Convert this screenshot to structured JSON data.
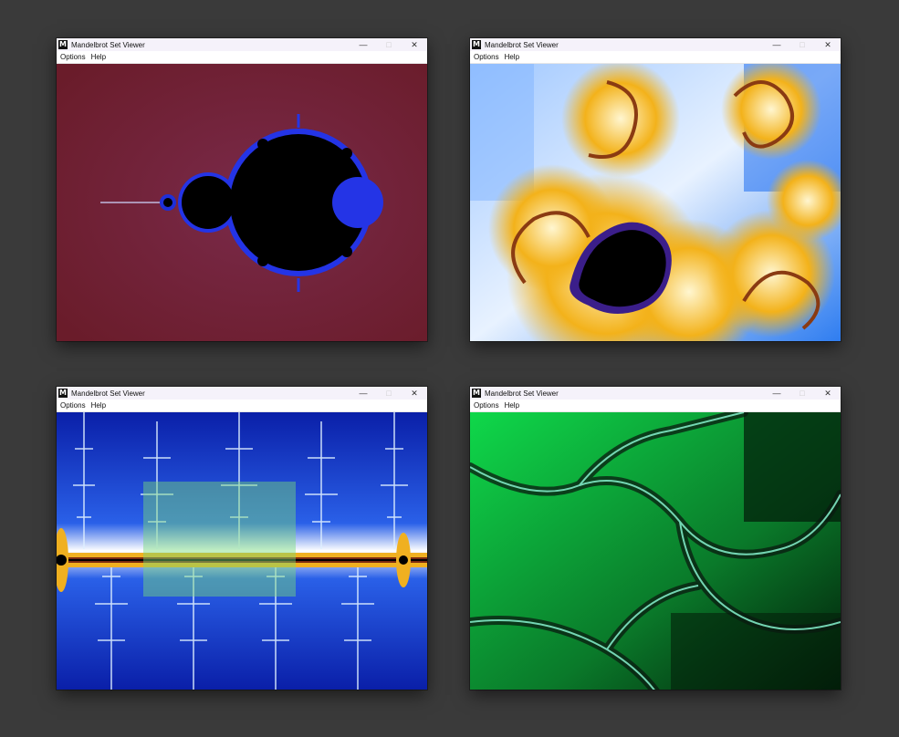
{
  "windows": [
    {
      "title": "Mandelbrot Set Viewer",
      "menu": [
        "Options",
        "Help"
      ],
      "view": "classic-red-full-set"
    },
    {
      "title": "Mandelbrot Set Viewer",
      "menu": [
        "Options",
        "Help"
      ],
      "view": "blue-gold-seahorse-valley"
    },
    {
      "title": "Mandelbrot Set Viewer",
      "menu": [
        "Options",
        "Help"
      ],
      "view": "blue-antenna-with-zoom-selection"
    },
    {
      "title": "Mandelbrot Set Viewer",
      "menu": [
        "Options",
        "Help"
      ],
      "view": "green-dendrite"
    }
  ],
  "controls": {
    "minimize": "—",
    "maximize": "□",
    "close": "✕"
  },
  "icons": {
    "app": "M"
  },
  "colors": {
    "desktop": "#3a3a3a",
    "win1_bg": "#6e1f2e",
    "win2_bg": "#bcdcff",
    "win3_bg": "#0f2fb0",
    "win4_bg": "#0c9a34",
    "selection": "#78dc78"
  }
}
